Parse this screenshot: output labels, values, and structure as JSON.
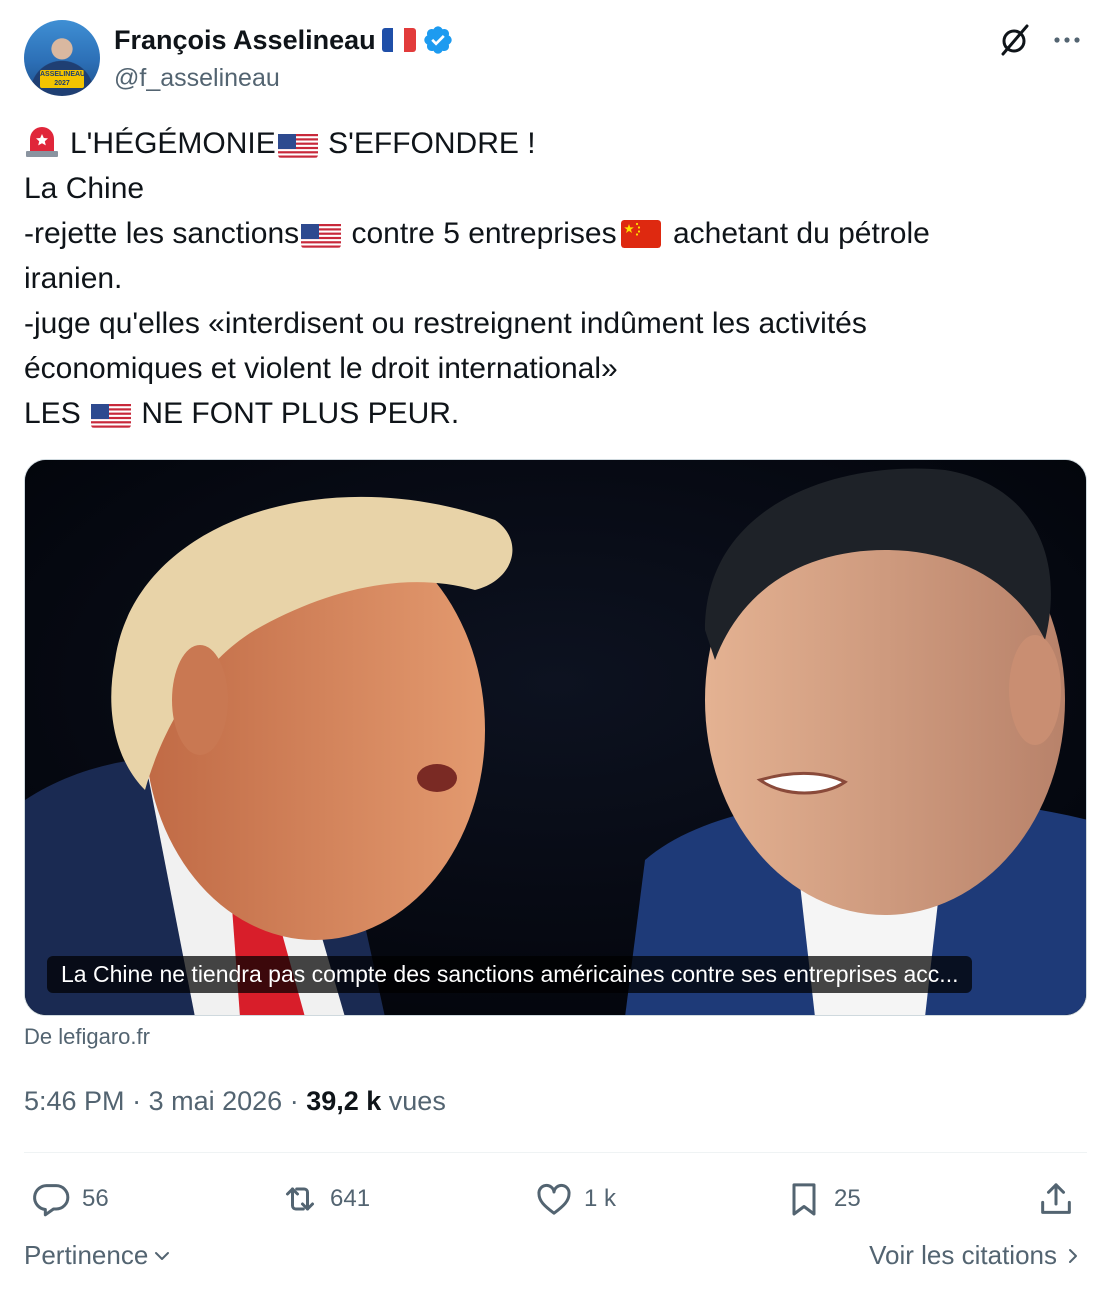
{
  "author": {
    "display_name": "François Asselineau",
    "handle": "@f_asselineau",
    "avatar_badge": "ASSELINEAU 2027"
  },
  "tweet": {
    "line1_a": "L'HÉGÉMONIE",
    "line1_b": "S'EFFONDRE !",
    "line2": "La Chine",
    "line3_a": "-rejette les sanctions",
    "line3_b": "contre 5 entreprises",
    "line3_c": "achetant du pétrole",
    "line4": "iranien.",
    "line5": "-juge qu'elles «interdisent ou restreignent indûment les activités",
    "line6": "économiques et violent le droit international»",
    "line7_a": "LES",
    "line7_b": "NE FONT PLUS PEUR."
  },
  "card": {
    "caption": "La Chine ne tiendra pas compte des sanctions américaines contre ses entreprises acc...",
    "source": "De lefigaro.fr"
  },
  "meta": {
    "time": "5:46 PM",
    "date": "3 mai 2026",
    "views_count": "39,2 k",
    "views_label": "vues"
  },
  "actions": {
    "replies": "56",
    "reposts": "641",
    "likes": "1 k",
    "bookmarks": "25"
  },
  "footer": {
    "sort_label": "Pertinence",
    "quotes_label": "Voir les citations"
  },
  "colors": {
    "text_primary": "#0f1419",
    "text_secondary": "#536471",
    "verified_blue": "#1d9bf0",
    "divider": "#eff3f4"
  },
  "icons": [
    "grok-icon",
    "more-icon",
    "verified-icon",
    "reply-icon",
    "repost-icon",
    "like-icon",
    "bookmark-icon",
    "share-icon",
    "chevron-down-icon",
    "chevron-right-icon",
    "siren-emoji",
    "us-flag-emoji",
    "china-flag-emoji",
    "france-flag-emoji"
  ]
}
